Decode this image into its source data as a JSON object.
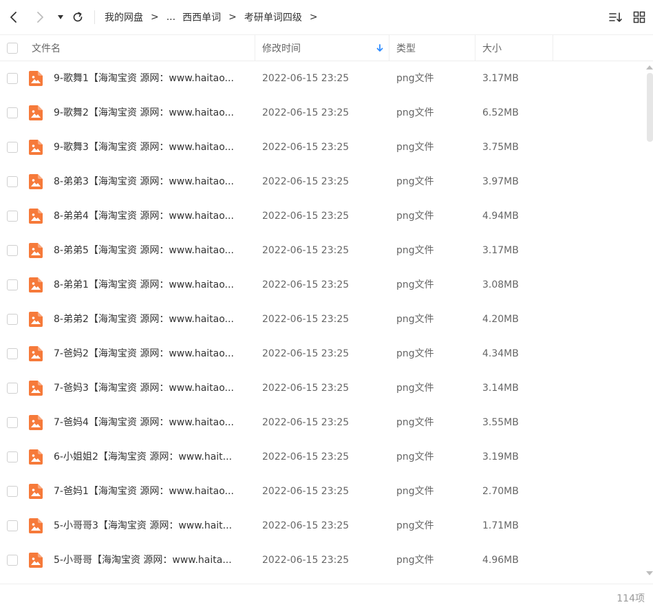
{
  "toolbar": {
    "back_icon": "chevron-left-icon",
    "forward_icon": "chevron-right-icon",
    "dropdown_icon": "caret-down-icon",
    "refresh_icon": "refresh-icon",
    "sort_icon": "sort-list-icon",
    "grid_icon": "grid-view-icon"
  },
  "breadcrumb": {
    "items": [
      "我的网盘",
      "...",
      "西西单词",
      "考研单词四级"
    ],
    "separator": ">"
  },
  "header": {
    "name": "文件名",
    "time": "修改时间",
    "type": "类型",
    "size": "大小",
    "sort_indicator_color": "#2f8cff"
  },
  "files": [
    {
      "name": "9-歌舞1【海淘宝资 源网：www.haitao...",
      "time": "2022-06-15 23:25",
      "type": "png文件",
      "size": "3.17MB"
    },
    {
      "name": "9-歌舞2【海淘宝资 源网：www.haitao...",
      "time": "2022-06-15 23:25",
      "type": "png文件",
      "size": "6.52MB"
    },
    {
      "name": "9-歌舞3【海淘宝资 源网：www.haitao...",
      "time": "2022-06-15 23:25",
      "type": "png文件",
      "size": "3.75MB"
    },
    {
      "name": "8-弟弟3【海淘宝资 源网：www.haitao...",
      "time": "2022-06-15 23:25",
      "type": "png文件",
      "size": "3.97MB"
    },
    {
      "name": "8-弟弟4【海淘宝资 源网：www.haitao...",
      "time": "2022-06-15 23:25",
      "type": "png文件",
      "size": "4.94MB"
    },
    {
      "name": "8-弟弟5【海淘宝资 源网：www.haitao...",
      "time": "2022-06-15 23:25",
      "type": "png文件",
      "size": "3.17MB"
    },
    {
      "name": "8-弟弟1【海淘宝资 源网：www.haitao...",
      "time": "2022-06-15 23:25",
      "type": "png文件",
      "size": "3.08MB"
    },
    {
      "name": "8-弟弟2【海淘宝资 源网：www.haitao...",
      "time": "2022-06-15 23:25",
      "type": "png文件",
      "size": "4.20MB"
    },
    {
      "name": "7-爸妈2【海淘宝资 源网：www.haitao...",
      "time": "2022-06-15 23:25",
      "type": "png文件",
      "size": "4.34MB"
    },
    {
      "name": "7-爸妈3【海淘宝资 源网：www.haitao...",
      "time": "2022-06-15 23:25",
      "type": "png文件",
      "size": "3.14MB"
    },
    {
      "name": "7-爸妈4【海淘宝资 源网：www.haitao...",
      "time": "2022-06-15 23:25",
      "type": "png文件",
      "size": "3.55MB"
    },
    {
      "name": "6-小姐姐2【海淘宝资 源网：www.hait...",
      "time": "2022-06-15 23:25",
      "type": "png文件",
      "size": "3.19MB"
    },
    {
      "name": "7-爸妈1【海淘宝资 源网：www.haitao...",
      "time": "2022-06-15 23:25",
      "type": "png文件",
      "size": "2.70MB"
    },
    {
      "name": "5-小哥哥3【海淘宝资 源网：www.hait...",
      "time": "2022-06-15 23:25",
      "type": "png文件",
      "size": "1.71MB"
    },
    {
      "name": "5-小哥哥【海淘宝资 源网：www.haita...",
      "time": "2022-06-15 23:25",
      "type": "png文件",
      "size": "4.96MB"
    }
  ],
  "file_icon": "image-file-icon",
  "file_icon_color": "#f67a3a",
  "footer": {
    "count": "114项"
  }
}
